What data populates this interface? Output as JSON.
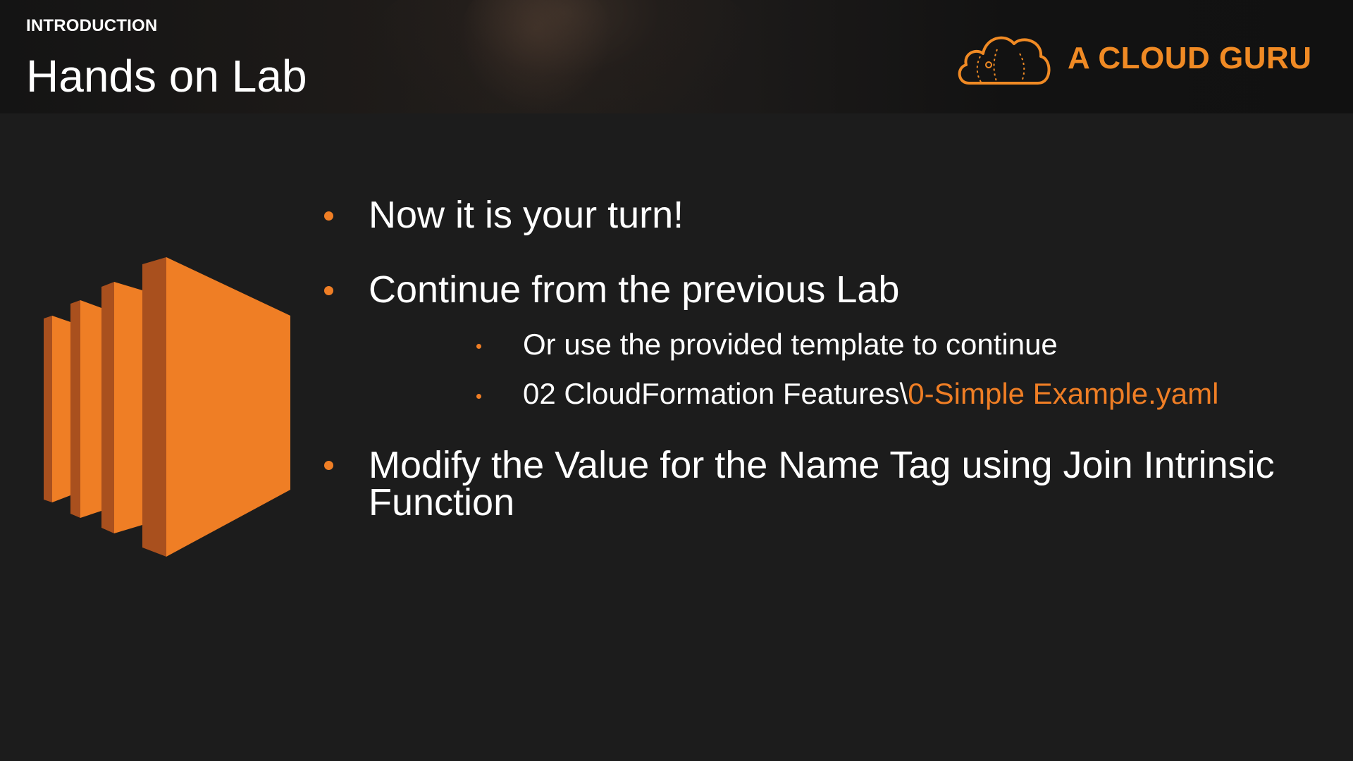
{
  "header": {
    "section_label": "INTRODUCTION",
    "title": "Hands on Lab",
    "brand": {
      "name": "A CLOUD GURU",
      "logo_icon": "cloud-icon",
      "color": "#f08a24"
    }
  },
  "illustration": {
    "icon": "aws-ec2-icon",
    "color": "#ef7e25"
  },
  "bullets": [
    {
      "text": "Now it is your turn!"
    },
    {
      "text": "Continue from the previous Lab",
      "sub": [
        {
          "text": "Or use the provided template to continue"
        },
        {
          "text_prefix": "02 CloudFormation Features\\",
          "text_highlight": "0-Simple Example.yaml"
        }
      ]
    },
    {
      "line1": "Modify the Value for the Name Tag using Join Intrinsic",
      "line2": "Function"
    }
  ],
  "colors": {
    "accent": "#ef7e25",
    "background": "#1c1c1c",
    "text": "#ffffff"
  }
}
